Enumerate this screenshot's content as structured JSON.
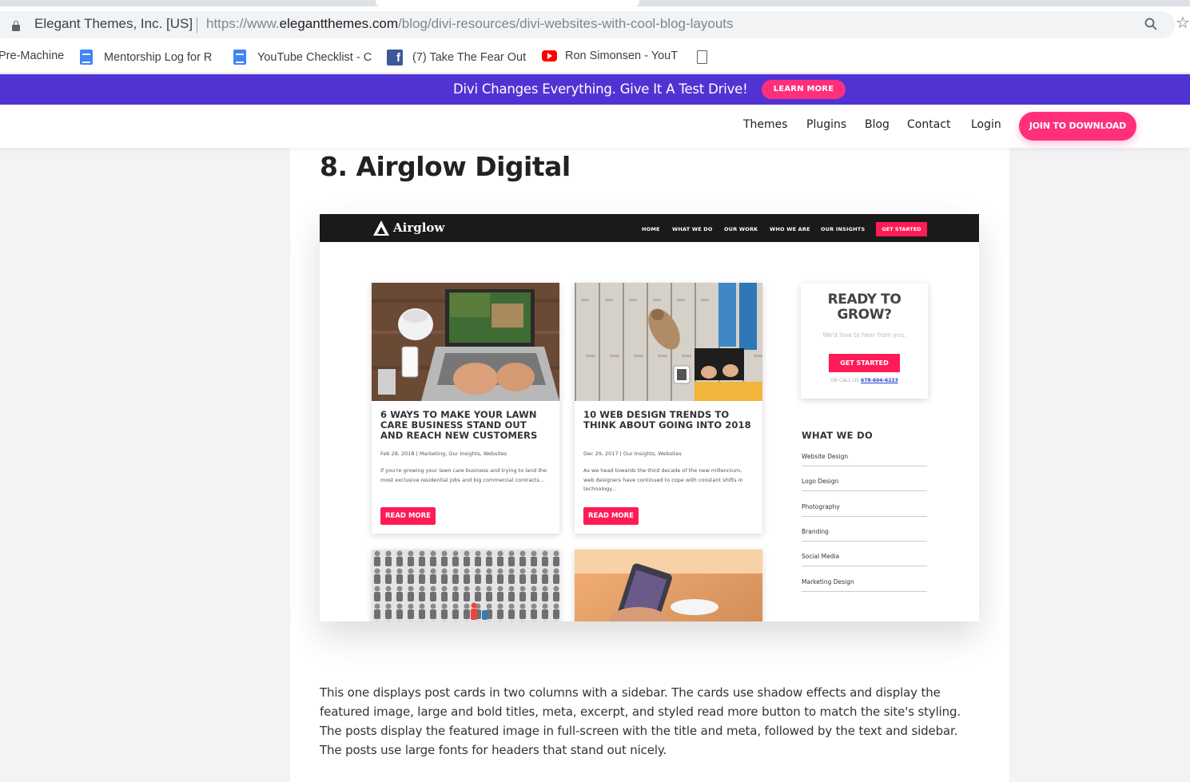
{
  "browser": {
    "site_identity": "Elegant Themes, Inc. [US]",
    "url_scheme": "https://www.",
    "url_host": "elegantthemes.com",
    "url_path": "/blog/divi-resources/divi-websites-with-cool-blog-layouts",
    "bookmarks": [
      {
        "label": "Pre-Machine",
        "icon": "none"
      },
      {
        "label": "Mentorship Log for R",
        "icon": "google-doc-icon"
      },
      {
        "label": "YouTube Checklist - C",
        "icon": "google-doc-icon"
      },
      {
        "label": "(7) Take The Fear Out",
        "icon": "facebook-icon"
      },
      {
        "label": "Ron Simonsen - YouT",
        "icon": "youtube-icon"
      }
    ]
  },
  "promo": {
    "text": "Divi Changes Everything. Give It A Test Drive!",
    "button": "LEARN MORE",
    "color": "#5133d4",
    "accent": "#ff2f7a"
  },
  "site_nav": {
    "items": [
      "Themes",
      "Plugins",
      "Blog",
      "Contact",
      "Login"
    ],
    "cta": "JOIN TO DOWNLOAD"
  },
  "article": {
    "title": "8. Airglow Digital",
    "body": "This one displays post cards in two columns with a sidebar. The cards use shadow effects and display the featured image, large and bold titles, meta, excerpt, and styled read more button to match the site's styling. The posts display the featured image in full-screen with the title and meta, followed by the text and sidebar. The posts use large fonts for headers that stand out nicely."
  },
  "airglow": {
    "logo": "Airglow",
    "nav": [
      "HOME",
      "WHAT WE DO",
      "OUR WORK",
      "WHO WE ARE",
      "OUR INSIGHTS"
    ],
    "nav_cta": "GET STARTED",
    "accent": "#ff1b56",
    "cards": [
      {
        "title": "6 WAYS TO MAKE YOUR LAWN CARE BUSINESS STAND OUT AND REACH NEW CUSTOMERS",
        "meta": "Feb 28, 2018 | Marketing, Our Insights, Websites",
        "excerpt": "If you're growing your lawn care business and trying to land the most exclusive residential jobs and big commercial contracts...",
        "button": "READ MORE"
      },
      {
        "title": "10 WEB DESIGN TRENDS TO THINK ABOUT GOING INTO 2018",
        "meta": "Dec 29, 2017 | Our Insights, Websites",
        "excerpt": "As we head towards the third decade of the new millennium, web designers have continued to cope with constant shifts in technology...",
        "button": "READ MORE"
      }
    ],
    "ready": {
      "title": "READY TO GROW?",
      "subtitle": "We'd love to hear from you.",
      "button": "GET STARTED",
      "call_prefix": "OR CALL US",
      "phone": "678-604-6223"
    },
    "what_we_do": {
      "title": "WHAT WE DO",
      "items": [
        "Website Design",
        "Logo Design",
        "Photography",
        "Branding",
        "Social Media",
        "Marketing Design"
      ]
    }
  }
}
